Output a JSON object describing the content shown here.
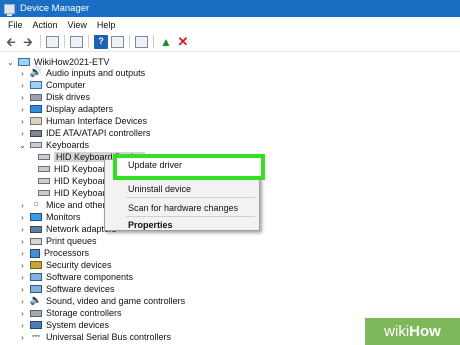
{
  "window": {
    "title": "Device Manager"
  },
  "menu": [
    "File",
    "Action",
    "View",
    "Help"
  ],
  "tree": {
    "root": "WikiHow2021-ETV",
    "categories": [
      "Audio inputs and outputs",
      "Computer",
      "Disk drives",
      "Display adapters",
      "Human Interface Devices",
      "IDE ATA/ATAPI controllers",
      "Keyboards"
    ],
    "keyboards": [
      "HID Keyboard Device",
      "HID Keyboard Device",
      "HID Keyboard Device",
      "HID Keyboard Device"
    ],
    "more_categories": [
      "Mice and other pointing devices",
      "Monitors",
      "Network adapters",
      "Print queues",
      "Processors",
      "Security devices",
      "Software components",
      "Software devices",
      "Sound, video and game controllers",
      "Storage controllers",
      "System devices",
      "Universal Serial Bus controllers"
    ]
  },
  "context_menu": {
    "update_driver": "Update driver",
    "uninstall": "Uninstall device",
    "scan": "Scan for hardware changes",
    "properties": "Properties"
  },
  "watermark": {
    "part1": "wiki",
    "part2": "How"
  },
  "colors": {
    "titlebar": "#1a6fc4",
    "highlight": "#33e026",
    "watermark": "#7db85a"
  }
}
